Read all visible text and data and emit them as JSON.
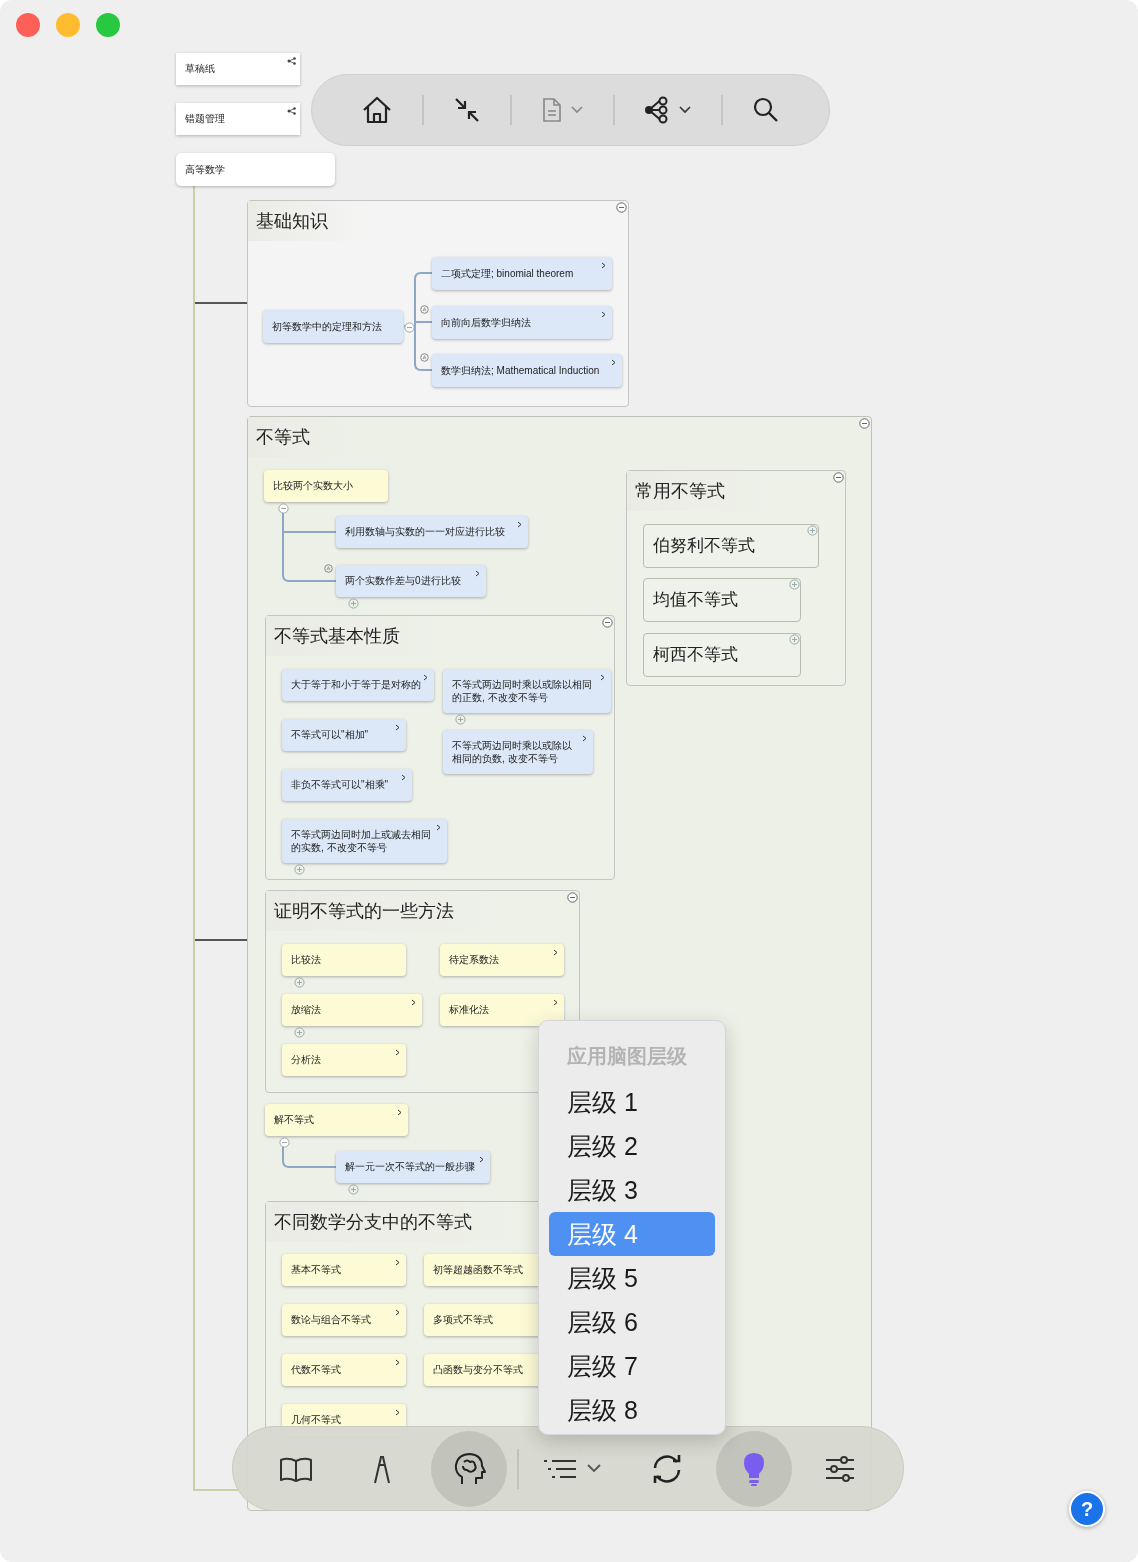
{
  "sheets": [
    {
      "label": "草稿纸",
      "linked": true
    },
    {
      "label": "错题管理",
      "linked": true
    }
  ],
  "map": {
    "root": {
      "label": "高等数学"
    },
    "topics": [
      {
        "title": "基础知识",
        "expanded": true,
        "items": [
          {
            "kind": "node",
            "label": "初等数学中的定理和方法",
            "color": "#dce8f8",
            "link": false,
            "collapsed": false,
            "marked": false,
            "expanded": true,
            "children": [
              {
                "label": "二项式定理; binomial theorem",
                "color": "#dce8f8",
                "link": true,
                "collapsed": false,
                "marked": false
              },
              {
                "label": "向前向后数学归纳法",
                "color": "#dce8f8",
                "link": true,
                "collapsed": false,
                "marked": true
              },
              {
                "label": "数学归纳法; Mathematical Induction",
                "color": "#dce8f8",
                "link": true,
                "collapsed": false,
                "marked": true
              }
            ]
          }
        ]
      },
      {
        "title": "不等式",
        "expanded": true,
        "items": [
          {
            "kind": "node",
            "label": "比较两个实数大小",
            "color": "#fdfad6",
            "link": false,
            "collapsed": false,
            "marked": false,
            "expanded": true,
            "children": [
              {
                "label": "利用数轴与实数的一一对应进行比较",
                "color": "#dce8f8",
                "link": true,
                "collapsed": false,
                "marked": false
              },
              {
                "label": "两个实数作差与0进行比较",
                "color": "#dce8f8",
                "link": true,
                "collapsed": true,
                "marked": true
              }
            ]
          },
          {
            "kind": "group",
            "title": "常用不等式",
            "expanded": true,
            "items": [
              {
                "kind": "node",
                "label": "伯努利不等式",
                "color": "#eef2ea",
                "link": false,
                "collapsed": true,
                "marked": false
              },
              {
                "kind": "node",
                "label": "均值不等式",
                "color": "#eef2ea",
                "link": false,
                "collapsed": true,
                "marked": false
              },
              {
                "kind": "node",
                "label": "柯西不等式",
                "color": "#eef2ea",
                "link": false,
                "collapsed": true,
                "marked": false
              }
            ]
          },
          {
            "kind": "group",
            "title": "不等式基本性质",
            "expanded": true,
            "items": [
              {
                "kind": "node",
                "label": "大于等于和小于等于是对称的",
                "color": "#dce8f8",
                "link": true,
                "collapsed": false,
                "marked": false
              },
              {
                "kind": "node",
                "label": "不等式两边同时乘以或除以相同的正数, 不改变不等号",
                "color": "#dce8f8",
                "link": true,
                "collapsed": true,
                "marked": false
              },
              {
                "kind": "node",
                "label": "不等式可以\"相加\"",
                "color": "#dce8f8",
                "link": true,
                "collapsed": false,
                "marked": false
              },
              {
                "kind": "node",
                "label": "不等式两边同时乘以或除以相同的负数, 改变不等号",
                "color": "#dce8f8",
                "link": true,
                "collapsed": false,
                "marked": false
              },
              {
                "kind": "node",
                "label": "非负不等式可以\"相乘\"",
                "color": "#dce8f8",
                "link": true,
                "collapsed": false,
                "marked": false
              },
              {
                "kind": "node",
                "label": "不等式两边同时加上或减去相同的实数, 不改变不等号",
                "color": "#dce8f8",
                "link": true,
                "collapsed": true,
                "marked": false
              }
            ]
          },
          {
            "kind": "group",
            "title": "证明不等式的一些方法",
            "expanded": true,
            "items": [
              {
                "kind": "node",
                "label": "比较法",
                "color": "#fdfad6",
                "link": false,
                "collapsed": true,
                "marked": false
              },
              {
                "kind": "node",
                "label": "待定系数法",
                "color": "#fdfad6",
                "link": true,
                "collapsed": false,
                "marked": false
              },
              {
                "kind": "node",
                "label": "放缩法",
                "color": "#fdfad6",
                "link": true,
                "collapsed": true,
                "marked": false
              },
              {
                "kind": "node",
                "label": "标准化法",
                "color": "#fdfad6",
                "link": true,
                "collapsed": false,
                "marked": false
              },
              {
                "kind": "node",
                "label": "分析法",
                "color": "#fdfad6",
                "link": true,
                "collapsed": false,
                "marked": false
              }
            ]
          },
          {
            "kind": "node",
            "label": "解不等式",
            "color": "#fdfad6",
            "link": true,
            "collapsed": false,
            "marked": false,
            "expanded": true,
            "children": [
              {
                "label": "解一元一次不等式的一般步骤",
                "color": "#dce8f8",
                "link": true,
                "collapsed": true,
                "marked": false
              }
            ]
          },
          {
            "kind": "group",
            "title": "不同数学分支中的不等式",
            "items": [
              {
                "kind": "node",
                "label": "基本不等式",
                "color": "#fdfad6",
                "link": true,
                "collapsed": false,
                "marked": false
              },
              {
                "kind": "node",
                "label": "初等超越函数不等式",
                "color": "#fdfad6",
                "link": false,
                "collapsed": false,
                "marked": false
              },
              {
                "kind": "node",
                "label": "数论与组合不等式",
                "color": "#fdfad6",
                "link": true,
                "collapsed": false,
                "marked": false
              },
              {
                "kind": "node",
                "label": "多项式不等式",
                "color": "#fdfad6",
                "link": false,
                "collapsed": false,
                "marked": false
              },
              {
                "kind": "node",
                "label": "代数不等式",
                "color": "#fdfad6",
                "link": true,
                "collapsed": false,
                "marked": false
              },
              {
                "kind": "node",
                "label": "凸函数与变分不等式",
                "color": "#fdfad6",
                "link": false,
                "collapsed": false,
                "marked": false
              },
              {
                "kind": "node",
                "label": "几何不等式",
                "color": "#fdfad6",
                "link": true,
                "collapsed": false,
                "marked": false
              }
            ]
          }
        ]
      }
    ]
  },
  "level_menu": {
    "title": "应用脑图层级",
    "items": [
      {
        "label": "层级 1",
        "selected": false
      },
      {
        "label": "层级 2",
        "selected": false
      },
      {
        "label": "层级 3",
        "selected": false
      },
      {
        "label": "层级 4",
        "selected": true
      },
      {
        "label": "层级 5",
        "selected": false
      },
      {
        "label": "层级 6",
        "selected": false
      },
      {
        "label": "层级 7",
        "selected": false
      },
      {
        "label": "层级 8",
        "selected": false
      }
    ]
  },
  "bottom_toolbar": [
    {
      "selected": false
    },
    {
      "selected": false
    },
    {
      "selected": true
    },
    {
      "selected": false
    },
    {
      "selected": false
    },
    {
      "selected": true
    },
    {
      "selected": false
    }
  ],
  "help": {
    "label": "?"
  }
}
